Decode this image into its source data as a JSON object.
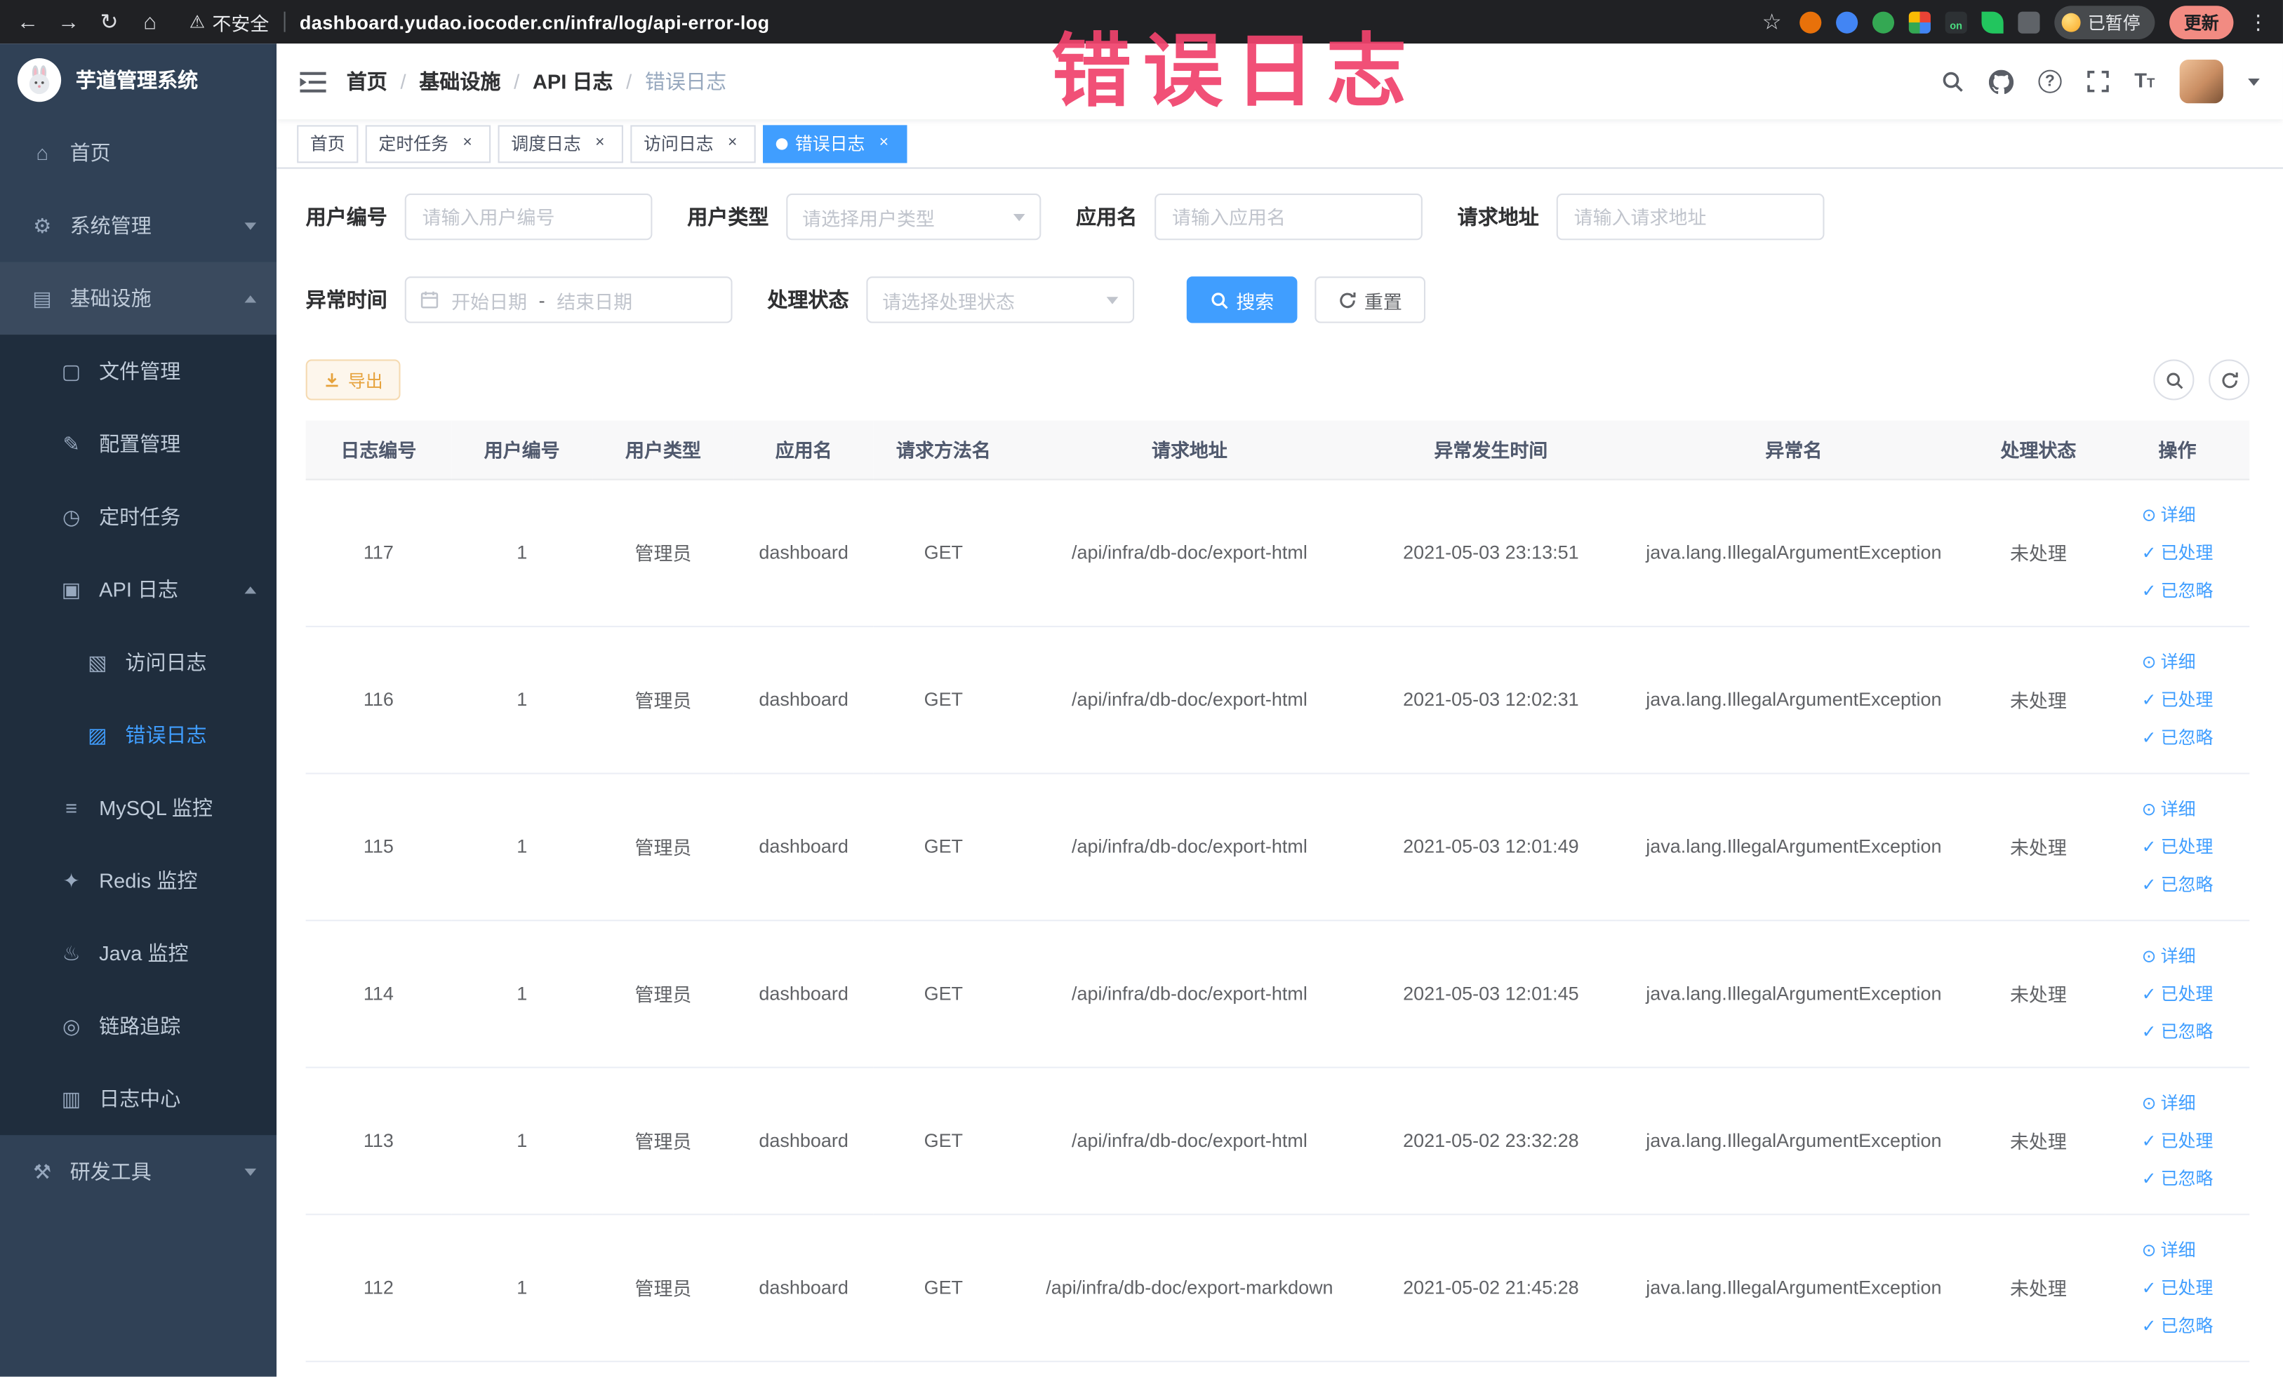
{
  "annotation": {
    "title": "错误日志"
  },
  "ui": {
    "breadcrumb_separator": "/"
  },
  "icons": {
    "back": "←",
    "forward": "→",
    "reload": "↻",
    "home": "⌂",
    "warning": "⚠",
    "star": "☆",
    "kebab": "⋮",
    "close": "×",
    "view": "⊙",
    "check": "✓",
    "question": "?",
    "font_size_big": "T",
    "font_size_small": "T",
    "menu_home": "⌂",
    "menu_system": "⚙",
    "menu_infra": "▤",
    "menu_file": "▢",
    "menu_config": "✎",
    "menu_job": "◷",
    "menu_api_log": "▣",
    "menu_access_log": "▧",
    "menu_error_log": "▨",
    "menu_mysql": "≡",
    "menu_redis": "✦",
    "menu_java": "♨",
    "menu_trace": "◎",
    "menu_log_center": "▥",
    "menu_devtools": "⚒"
  },
  "browser": {
    "security_label": "不安全",
    "url": "dashboard.yudao.iocoder.cn/infra/log/api-error-log",
    "paused_badge": "已暂停",
    "update_label": "更新",
    "extension_on_badge": "on"
  },
  "sidebar": {
    "logo_title": "芋道管理系统",
    "menu": [
      {
        "label": "首页"
      },
      {
        "label": "系统管理"
      },
      {
        "label": "基础设施"
      },
      {
        "label": "文件管理"
      },
      {
        "label": "配置管理"
      },
      {
        "label": "定时任务"
      },
      {
        "label": "API 日志"
      },
      {
        "label": "访问日志"
      },
      {
        "label": "错误日志"
      },
      {
        "label": "MySQL 监控"
      },
      {
        "label": "Redis 监控"
      },
      {
        "label": "Java 监控"
      },
      {
        "label": "链路追踪"
      },
      {
        "label": "日志中心"
      },
      {
        "label": "研发工具"
      }
    ]
  },
  "breadcrumb": [
    "首页",
    "基础设施",
    "API 日志",
    "错误日志"
  ],
  "tabs": [
    {
      "label": "首页"
    },
    {
      "label": "定时任务"
    },
    {
      "label": "调度日志"
    },
    {
      "label": "访问日志"
    },
    {
      "label": "错误日志"
    }
  ],
  "filters": {
    "user_id_label": "用户编号",
    "user_id_placeholder": "请输入用户编号",
    "user_type_label": "用户类型",
    "user_type_placeholder": "请选择用户类型",
    "app_name_label": "应用名",
    "app_name_placeholder": "请输入应用名",
    "request_url_label": "请求地址",
    "request_url_placeholder": "请输入请求地址",
    "exception_time_label": "异常时间",
    "start_date_placeholder": "开始日期",
    "date_separator": "-",
    "end_date_placeholder": "结束日期",
    "process_status_label": "处理状态",
    "process_status_placeholder": "请选择处理状态",
    "search_label": "搜索",
    "reset_label": "重置"
  },
  "toolbar": {
    "export_label": "导出"
  },
  "table": {
    "columns": [
      "日志编号",
      "用户编号",
      "用户类型",
      "应用名",
      "请求方法名",
      "请求地址",
      "异常发生时间",
      "异常名",
      "处理状态",
      "操作"
    ],
    "action_labels": {
      "detail": "详细",
      "processed": "已处理",
      "ignored": "已忽略"
    },
    "rows": [
      {
        "id": "117",
        "user_id": "1",
        "user_type": "管理员",
        "app": "dashboard",
        "method": "GET",
        "url": "/api/infra/db-doc/export-html",
        "time": "2021-05-03 23:13:51",
        "exception": "java.lang.IllegalArgumentException",
        "status": "未处理"
      },
      {
        "id": "116",
        "user_id": "1",
        "user_type": "管理员",
        "app": "dashboard",
        "method": "GET",
        "url": "/api/infra/db-doc/export-html",
        "time": "2021-05-03 12:02:31",
        "exception": "java.lang.IllegalArgumentException",
        "status": "未处理"
      },
      {
        "id": "115",
        "user_id": "1",
        "user_type": "管理员",
        "app": "dashboard",
        "method": "GET",
        "url": "/api/infra/db-doc/export-html",
        "time": "2021-05-03 12:01:49",
        "exception": "java.lang.IllegalArgumentException",
        "status": "未处理"
      },
      {
        "id": "114",
        "user_id": "1",
        "user_type": "管理员",
        "app": "dashboard",
        "method": "GET",
        "url": "/api/infra/db-doc/export-html",
        "time": "2021-05-03 12:01:45",
        "exception": "java.lang.IllegalArgumentException",
        "status": "未处理"
      },
      {
        "id": "113",
        "user_id": "1",
        "user_type": "管理员",
        "app": "dashboard",
        "method": "GET",
        "url": "/api/infra/db-doc/export-html",
        "time": "2021-05-02 23:32:28",
        "exception": "java.lang.IllegalArgumentException",
        "status": "未处理"
      },
      {
        "id": "112",
        "user_id": "1",
        "user_type": "管理员",
        "app": "dashboard",
        "method": "GET",
        "url": "/api/infra/db-doc/export-markdown",
        "time": "2021-05-02 21:45:28",
        "exception": "java.lang.IllegalArgumentException",
        "status": "未处理"
      }
    ]
  },
  "colors": {
    "accent": "#409eff",
    "warning": "#e6a23c",
    "annotation": "#f0436d",
    "sidebar_bg": "#304156",
    "submenu_bg": "#1f2d3d"
  }
}
